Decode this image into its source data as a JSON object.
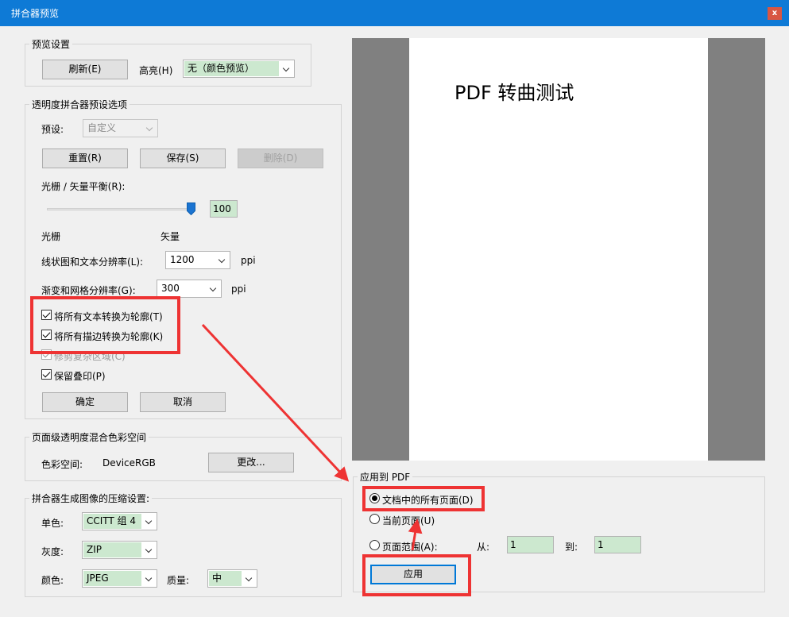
{
  "window": {
    "title": "拼合器预览",
    "close_label": "x"
  },
  "preview_settings": {
    "legend": "预览设置",
    "refresh_label": "刷新(E)",
    "highlight_label": "高亮(H)",
    "highlight_value": "无（颜色预览）"
  },
  "flattener_presets": {
    "legend": "透明度拼合器预设选项",
    "preset_label": "预设:",
    "preset_value": "自定义",
    "reset_label": "重置(R)",
    "save_label": "保存(S)",
    "delete_label": "删除(D)",
    "balance_label": "光栅 / 矢量平衡(R):",
    "balance_value": "100",
    "balance_fraction": 1.0,
    "raster_label": "光栅",
    "vector_label": "矢量",
    "line_res_label": "线状图和文本分辨率(L):",
    "line_res_value": "1200",
    "ppi": "ppi",
    "gradient_res_label": "渐变和网格分辨率(G):",
    "gradient_res_value": "300",
    "convert_text_label": "将所有文本转换为轮廓(T)",
    "convert_strokes_label": "将所有描边转换为轮廓(K)",
    "clip_complex_label": "修剪复杂区域(C)",
    "preserve_overprint_label": "保留叠印(P)",
    "ok_label": "确定",
    "cancel_label": "取消"
  },
  "blend_space": {
    "legend": "页面级透明度混合色彩空间",
    "color_space_label": "色彩空间:",
    "color_space_value": "DeviceRGB",
    "change_label": "更改..."
  },
  "compression": {
    "legend": "拼合器生成图像的压缩设置:",
    "mono_label": "单色:",
    "mono_value": "CCITT 组 4",
    "gray_label": "灰度:",
    "gray_value": "ZIP",
    "color_label": "颜色:",
    "color_value": "JPEG",
    "quality_label": "质量:",
    "quality_value": "中"
  },
  "preview": {
    "text": "PDF 转曲测试"
  },
  "apply_to_pdf": {
    "legend": "应用到 PDF",
    "all_pages_label": "文档中的所有页面(D)",
    "current_page_label": "当前页面(U)",
    "page_range_label": "页面范围(A):",
    "from_label": "从:",
    "from_value": "1",
    "to_label": "到:",
    "to_value": "1",
    "apply_label": "应用"
  },
  "colors": {
    "accent": "#0e7ad6",
    "highlight_red": "#ee3333",
    "field_green": "#cce8cf"
  }
}
